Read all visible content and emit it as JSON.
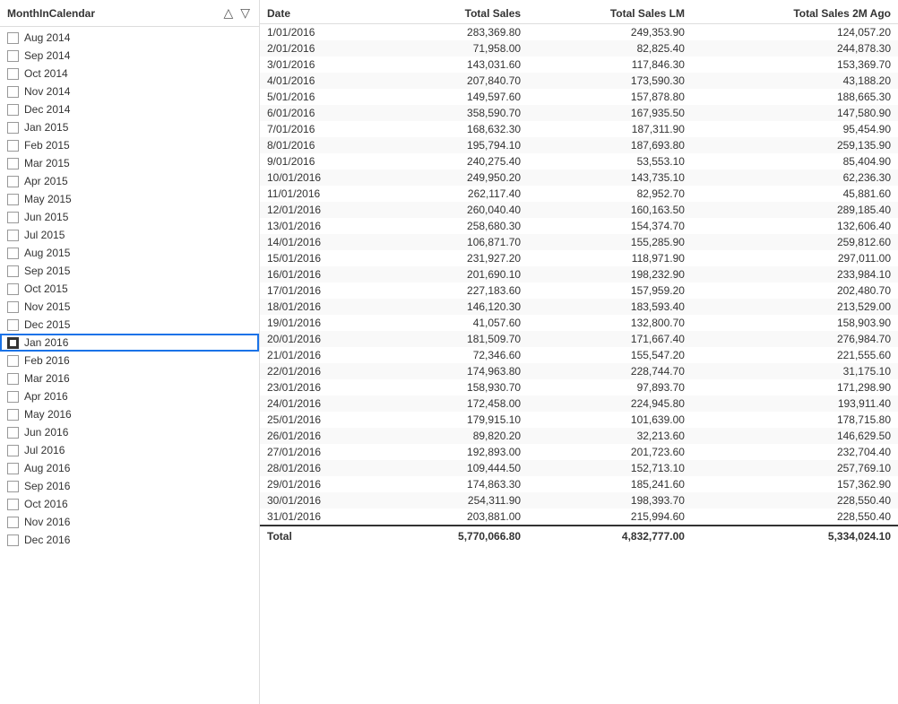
{
  "leftPanel": {
    "title": "MonthInCalendar",
    "sortAscIcon": "△",
    "sortDescIcon": "▽",
    "items": [
      {
        "label": "Aug 2014",
        "checked": false,
        "selected": false
      },
      {
        "label": "Sep 2014",
        "checked": false,
        "selected": false
      },
      {
        "label": "Oct 2014",
        "checked": false,
        "selected": false
      },
      {
        "label": "Nov 2014",
        "checked": false,
        "selected": false
      },
      {
        "label": "Dec 2014",
        "checked": false,
        "selected": false
      },
      {
        "label": "Jan 2015",
        "checked": false,
        "selected": false
      },
      {
        "label": "Feb 2015",
        "checked": false,
        "selected": false
      },
      {
        "label": "Mar 2015",
        "checked": false,
        "selected": false
      },
      {
        "label": "Apr 2015",
        "checked": false,
        "selected": false
      },
      {
        "label": "May 2015",
        "checked": false,
        "selected": false
      },
      {
        "label": "Jun 2015",
        "checked": false,
        "selected": false
      },
      {
        "label": "Jul 2015",
        "checked": false,
        "selected": false
      },
      {
        "label": "Aug 2015",
        "checked": false,
        "selected": false
      },
      {
        "label": "Sep 2015",
        "checked": false,
        "selected": false
      },
      {
        "label": "Oct 2015",
        "checked": false,
        "selected": false
      },
      {
        "label": "Nov 2015",
        "checked": false,
        "selected": false
      },
      {
        "label": "Dec 2015",
        "checked": false,
        "selected": false
      },
      {
        "label": "Jan 2016",
        "checked": true,
        "selected": true
      },
      {
        "label": "Feb 2016",
        "checked": false,
        "selected": false,
        "cursor": true
      },
      {
        "label": "Mar 2016",
        "checked": false,
        "selected": false
      },
      {
        "label": "Apr 2016",
        "checked": false,
        "selected": false
      },
      {
        "label": "May 2016",
        "checked": false,
        "selected": false
      },
      {
        "label": "Jun 2016",
        "checked": false,
        "selected": false
      },
      {
        "label": "Jul 2016",
        "checked": false,
        "selected": false
      },
      {
        "label": "Aug 2016",
        "checked": false,
        "selected": false
      },
      {
        "label": "Sep 2016",
        "checked": false,
        "selected": false
      },
      {
        "label": "Oct 2016",
        "checked": false,
        "selected": false
      },
      {
        "label": "Nov 2016",
        "checked": false,
        "selected": false
      },
      {
        "label": "Dec 2016",
        "checked": false,
        "selected": false
      }
    ]
  },
  "table": {
    "columns": [
      "Date",
      "Total Sales",
      "Total Sales LM",
      "Total Sales 2M Ago"
    ],
    "rows": [
      [
        "1/01/2016",
        "283,369.80",
        "249,353.90",
        "124,057.20"
      ],
      [
        "2/01/2016",
        "71,958.00",
        "82,825.40",
        "244,878.30"
      ],
      [
        "3/01/2016",
        "143,031.60",
        "117,846.30",
        "153,369.70"
      ],
      [
        "4/01/2016",
        "207,840.70",
        "173,590.30",
        "43,188.20"
      ],
      [
        "5/01/2016",
        "149,597.60",
        "157,878.80",
        "188,665.30"
      ],
      [
        "6/01/2016",
        "358,590.70",
        "167,935.50",
        "147,580.90"
      ],
      [
        "7/01/2016",
        "168,632.30",
        "187,311.90",
        "95,454.90"
      ],
      [
        "8/01/2016",
        "195,794.10",
        "187,693.80",
        "259,135.90"
      ],
      [
        "9/01/2016",
        "240,275.40",
        "53,553.10",
        "85,404.90"
      ],
      [
        "10/01/2016",
        "249,950.20",
        "143,735.10",
        "62,236.30"
      ],
      [
        "11/01/2016",
        "262,117.40",
        "82,952.70",
        "45,881.60"
      ],
      [
        "12/01/2016",
        "260,040.40",
        "160,163.50",
        "289,185.40"
      ],
      [
        "13/01/2016",
        "258,680.30",
        "154,374.70",
        "132,606.40"
      ],
      [
        "14/01/2016",
        "106,871.70",
        "155,285.90",
        "259,812.60"
      ],
      [
        "15/01/2016",
        "231,927.20",
        "118,971.90",
        "297,011.00"
      ],
      [
        "16/01/2016",
        "201,690.10",
        "198,232.90",
        "233,984.10"
      ],
      [
        "17/01/2016",
        "227,183.60",
        "157,959.20",
        "202,480.70"
      ],
      [
        "18/01/2016",
        "146,120.30",
        "183,593.40",
        "213,529.00"
      ],
      [
        "19/01/2016",
        "41,057.60",
        "132,800.70",
        "158,903.90"
      ],
      [
        "20/01/2016",
        "181,509.70",
        "171,667.40",
        "276,984.70"
      ],
      [
        "21/01/2016",
        "72,346.60",
        "155,547.20",
        "221,555.60"
      ],
      [
        "22/01/2016",
        "174,963.80",
        "228,744.70",
        "31,175.10"
      ],
      [
        "23/01/2016",
        "158,930.70",
        "97,893.70",
        "171,298.90"
      ],
      [
        "24/01/2016",
        "172,458.00",
        "224,945.80",
        "193,911.40"
      ],
      [
        "25/01/2016",
        "179,915.10",
        "101,639.00",
        "178,715.80"
      ],
      [
        "26/01/2016",
        "89,820.20",
        "32,213.60",
        "146,629.50"
      ],
      [
        "27/01/2016",
        "192,893.00",
        "201,723.60",
        "232,704.40"
      ],
      [
        "28/01/2016",
        "109,444.50",
        "152,713.10",
        "257,769.10"
      ],
      [
        "29/01/2016",
        "174,863.30",
        "185,241.60",
        "157,362.90"
      ],
      [
        "30/01/2016",
        "254,311.90",
        "198,393.70",
        "228,550.40"
      ],
      [
        "31/01/2016",
        "203,881.00",
        "215,994.60",
        "228,550.40"
      ]
    ],
    "footer": [
      "Total",
      "5,770,066.80",
      "4,832,777.00",
      "5,334,024.10"
    ]
  }
}
